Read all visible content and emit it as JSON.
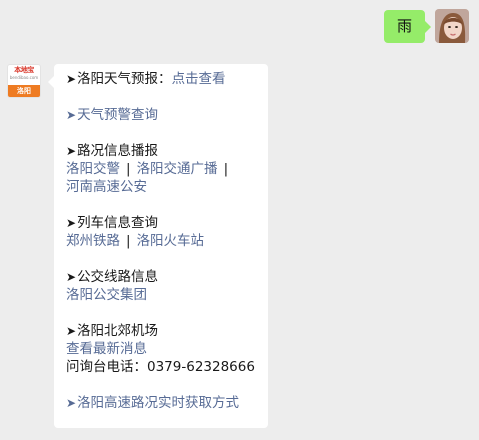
{
  "outgoing": {
    "text": "雨"
  },
  "official_account": {
    "brand": "本地宝",
    "site": "bendibao.com",
    "city": "洛阳"
  },
  "reply": {
    "weather": {
      "label": "洛阳天气预报：",
      "link": "点击查看"
    },
    "warning": {
      "link": "天气预警查询"
    },
    "traffic": {
      "label": "路况信息播报",
      "links": [
        "洛阳交警",
        "洛阳交通广播",
        "河南高速公安"
      ],
      "sep": "|"
    },
    "train": {
      "label": "列车信息查询",
      "links": [
        "郑州铁路",
        "洛阳火车站"
      ],
      "sep": "|"
    },
    "bus": {
      "label": "公交线路信息",
      "link": "洛阳公交集团"
    },
    "airport": {
      "label": "洛阳北郊机场",
      "link": "查看最新消息",
      "phone": "问询台电话：0379-62328666"
    },
    "highway": {
      "link": "洛阳高速路况实时获取方式"
    }
  },
  "colors": {
    "background": "#ededed",
    "outgoing_bubble": "#95ec69",
    "incoming_bubble": "#ffffff",
    "link": "#576b95",
    "brand_red": "#d9372a",
    "city_orange": "#ee7b22"
  }
}
